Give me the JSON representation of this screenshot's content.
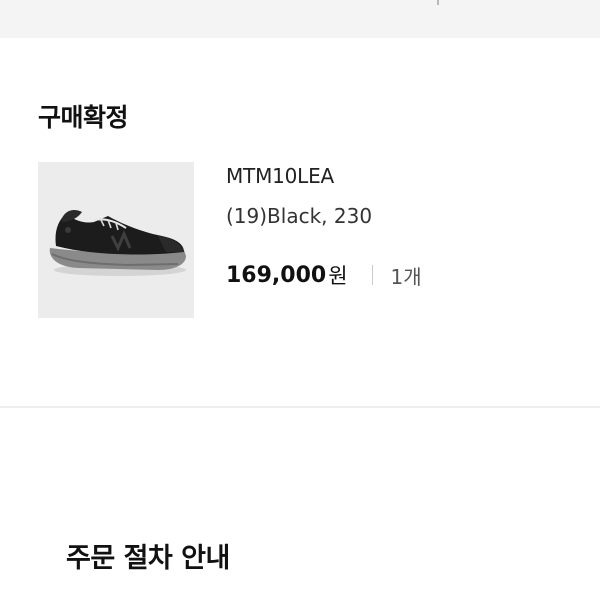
{
  "order": {
    "status_title": "구매확정",
    "item": {
      "image_icon": "black-sneaker-product-image",
      "name": "MTM10LEA",
      "option": "(19)Black, 230",
      "price_amount": "169,000",
      "price_currency": "원",
      "quantity": "1개"
    }
  },
  "order_guide": {
    "title": "주문 절차 안내"
  },
  "colors": {
    "top_band": "#f4f4f4",
    "thumbnail_bg": "#ececec",
    "divider": "#eeeeee",
    "text_primary": "#111111",
    "text_secondary": "#555555"
  }
}
